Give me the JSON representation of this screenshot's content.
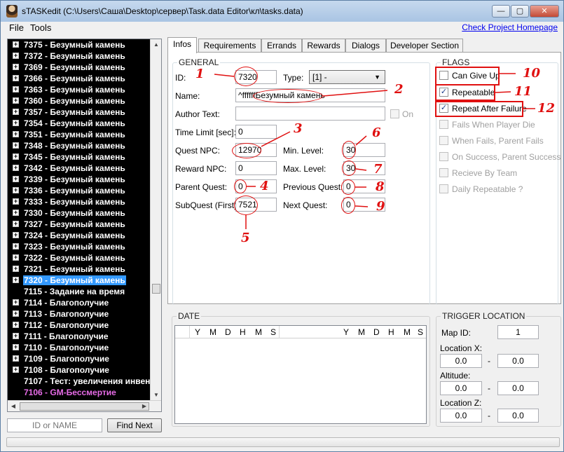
{
  "window": {
    "title": "sTASKedit (C:\\Users\\Саша\\Desktop\\сервер\\Task.data Editor\\кл\\tasks.data)",
    "buttons": {
      "minimize": "—",
      "maximize": "▢",
      "close": "✕"
    }
  },
  "menu": {
    "file": "File",
    "tools": "Tools",
    "check_link": "Check Project Homepage"
  },
  "tree": {
    "items": [
      {
        "label": "7375 - Безумный камень",
        "expandable": true
      },
      {
        "label": "7372 - Безумный камень",
        "expandable": true
      },
      {
        "label": "7369 - Безумный камень",
        "expandable": true
      },
      {
        "label": "7366 - Безумный камень",
        "expandable": true
      },
      {
        "label": "7363 - Безумный камень",
        "expandable": true
      },
      {
        "label": "7360 - Безумный камень",
        "expandable": true
      },
      {
        "label": "7357 - Безумный камень",
        "expandable": true
      },
      {
        "label": "7354 - Безумный камень",
        "expandable": true
      },
      {
        "label": "7351 - Безумный камень",
        "expandable": true
      },
      {
        "label": "7348 - Безумный камень",
        "expandable": true
      },
      {
        "label": "7345 - Безумный камень",
        "expandable": true
      },
      {
        "label": "7342 - Безумный камень",
        "expandable": true
      },
      {
        "label": "7339 - Безумный камень",
        "expandable": true
      },
      {
        "label": "7336 - Безумный камень",
        "expandable": true
      },
      {
        "label": "7333 - Безумный камень",
        "expandable": true
      },
      {
        "label": "7330 - Безумный камень",
        "expandable": true
      },
      {
        "label": "7327 - Безумный камень",
        "expandable": true
      },
      {
        "label": "7324 - Безумный камень",
        "expandable": true
      },
      {
        "label": "7323 - Безумный камень",
        "expandable": true
      },
      {
        "label": "7322 - Безумный камень",
        "expandable": true
      },
      {
        "label": "7321 - Безумный камень",
        "expandable": true
      },
      {
        "label": "7320 - Безумный камень",
        "expandable": true,
        "selected": true
      },
      {
        "label": "7115 - Задание на время",
        "expandable": false
      },
      {
        "label": "7114 - Благополучие",
        "expandable": true
      },
      {
        "label": "7113 - Благополучие",
        "expandable": true
      },
      {
        "label": "7112 - Благополучие",
        "expandable": true
      },
      {
        "label": "7111 - Благополучие",
        "expandable": true
      },
      {
        "label": "7110 - Благополучие",
        "expandable": true
      },
      {
        "label": "7109 - Благополучие",
        "expandable": true
      },
      {
        "label": "7108 - Благополучие",
        "expandable": true
      },
      {
        "label": "7107 - Тест: увеличения инвен",
        "expandable": false
      },
      {
        "label": "7106 - GM-Бессмертие",
        "expandable": false,
        "color": "pink"
      }
    ]
  },
  "search": {
    "placeholder": "ID or NAME",
    "find_next": "Find Next"
  },
  "tabs": [
    "Infos",
    "Requirements",
    "Errands",
    "Rewards",
    "Dialogs",
    "Developer Section"
  ],
  "general": {
    "title": "GENERAL",
    "id_label": "ID:",
    "id_value": "7320",
    "type_label": "Type:",
    "type_value": "[1] -",
    "name_label": "Name:",
    "name_value": "^ffffffБезумный камень",
    "author_label": "Author Text:",
    "author_value": "",
    "on_label": "On",
    "time_limit_label": "Time Limit [sec]:",
    "time_limit_value": "0",
    "quest_npc_label": "Quest NPC:",
    "quest_npc_value": "12970",
    "min_level_label": "Min. Level:",
    "min_level_value": "30",
    "reward_npc_label": "Reward NPC:",
    "reward_npc_value": "0",
    "max_level_label": "Max. Level:",
    "max_level_value": "30",
    "parent_quest_label": "Parent Quest:",
    "parent_quest_value": "0",
    "previous_quest_label": "Previous Quest:",
    "previous_quest_value": "0",
    "subquest_label": "SubQuest (First):",
    "subquest_value": "7521",
    "next_quest_label": "Next Quest:",
    "next_quest_value": "0"
  },
  "flags": {
    "title": "FLAGS",
    "items": [
      {
        "label": "Can Give Up",
        "checked": false,
        "enabled": true
      },
      {
        "label": "Repeatable",
        "checked": true,
        "enabled": true
      },
      {
        "label": "Repeat After Failure",
        "checked": true,
        "enabled": true
      },
      {
        "label": "Fails When Player Die",
        "checked": false,
        "enabled": false
      },
      {
        "label": "When Fails, Parent Fails",
        "checked": false,
        "enabled": false
      },
      {
        "label": "On Success, Parent Success",
        "checked": false,
        "enabled": false
      },
      {
        "label": "Recieve By Team",
        "checked": false,
        "enabled": false
      },
      {
        "label": "Daily Repeatable ?",
        "checked": false,
        "enabled": false
      }
    ]
  },
  "date": {
    "title": "DATE",
    "columns": [
      "Y",
      "M",
      "D",
      "H",
      "M",
      "S",
      "Y",
      "M",
      "D",
      "H",
      "M",
      "S"
    ]
  },
  "trigger": {
    "title": "TRIGGER LOCATION",
    "map_id_label": "Map ID:",
    "map_id_value": "1",
    "location_x_label": "Location X:",
    "x_from": "0.0",
    "x_to": "0.0",
    "altitude_label": "Altitude:",
    "alt_from": "0.0",
    "alt_to": "0.0",
    "location_z_label": "Location Z:",
    "z_from": "0.0",
    "z_to": "0.0",
    "dash": "-"
  },
  "annotations": {
    "color": "#e01010",
    "numbers": [
      "1",
      "2",
      "3",
      "4",
      "5",
      "6",
      "7",
      "8",
      "9",
      "10",
      "11",
      "12"
    ]
  }
}
